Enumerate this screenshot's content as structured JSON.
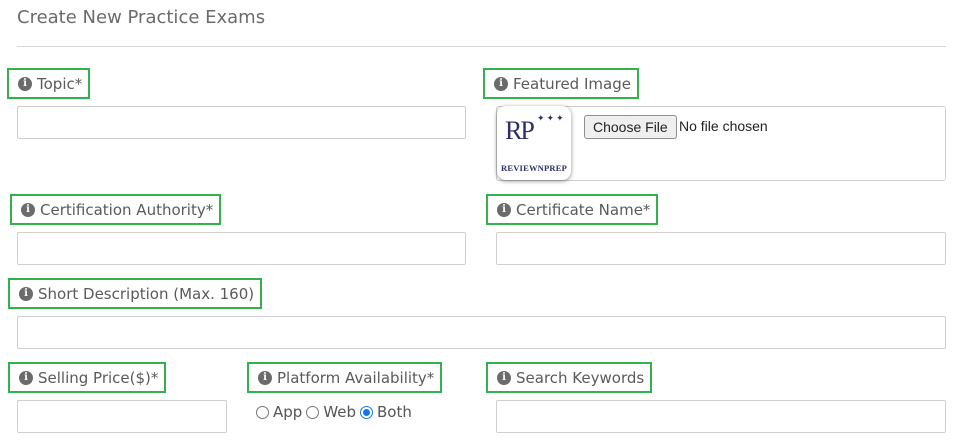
{
  "page": {
    "title": "Create New Practice Exams"
  },
  "fields": {
    "topic": {
      "label": "Topic*",
      "value": ""
    },
    "featured_image": {
      "label": "Featured Image",
      "choose_label": "Choose File",
      "status": "No file chosen",
      "logo": {
        "mark": "RP",
        "text": "REVIEWNPREP"
      }
    },
    "certification_authority": {
      "label": "Certification Authority*",
      "value": ""
    },
    "certificate_name": {
      "label": "Certificate Name*",
      "value": ""
    },
    "short_description": {
      "label": "Short Description (Max. 160)",
      "value": ""
    },
    "selling_price": {
      "label": "Selling Price($)*",
      "value": ""
    },
    "platform_availability": {
      "label": "Platform Availability*",
      "options": [
        "App",
        "Web",
        "Both"
      ],
      "selected": "Both"
    },
    "search_keywords": {
      "label": "Search Keywords",
      "value": ""
    }
  },
  "colors": {
    "highlight": "#2fb34a",
    "radio_selected": "#1a73e8"
  },
  "icons": {
    "info": "info-circle-icon"
  }
}
